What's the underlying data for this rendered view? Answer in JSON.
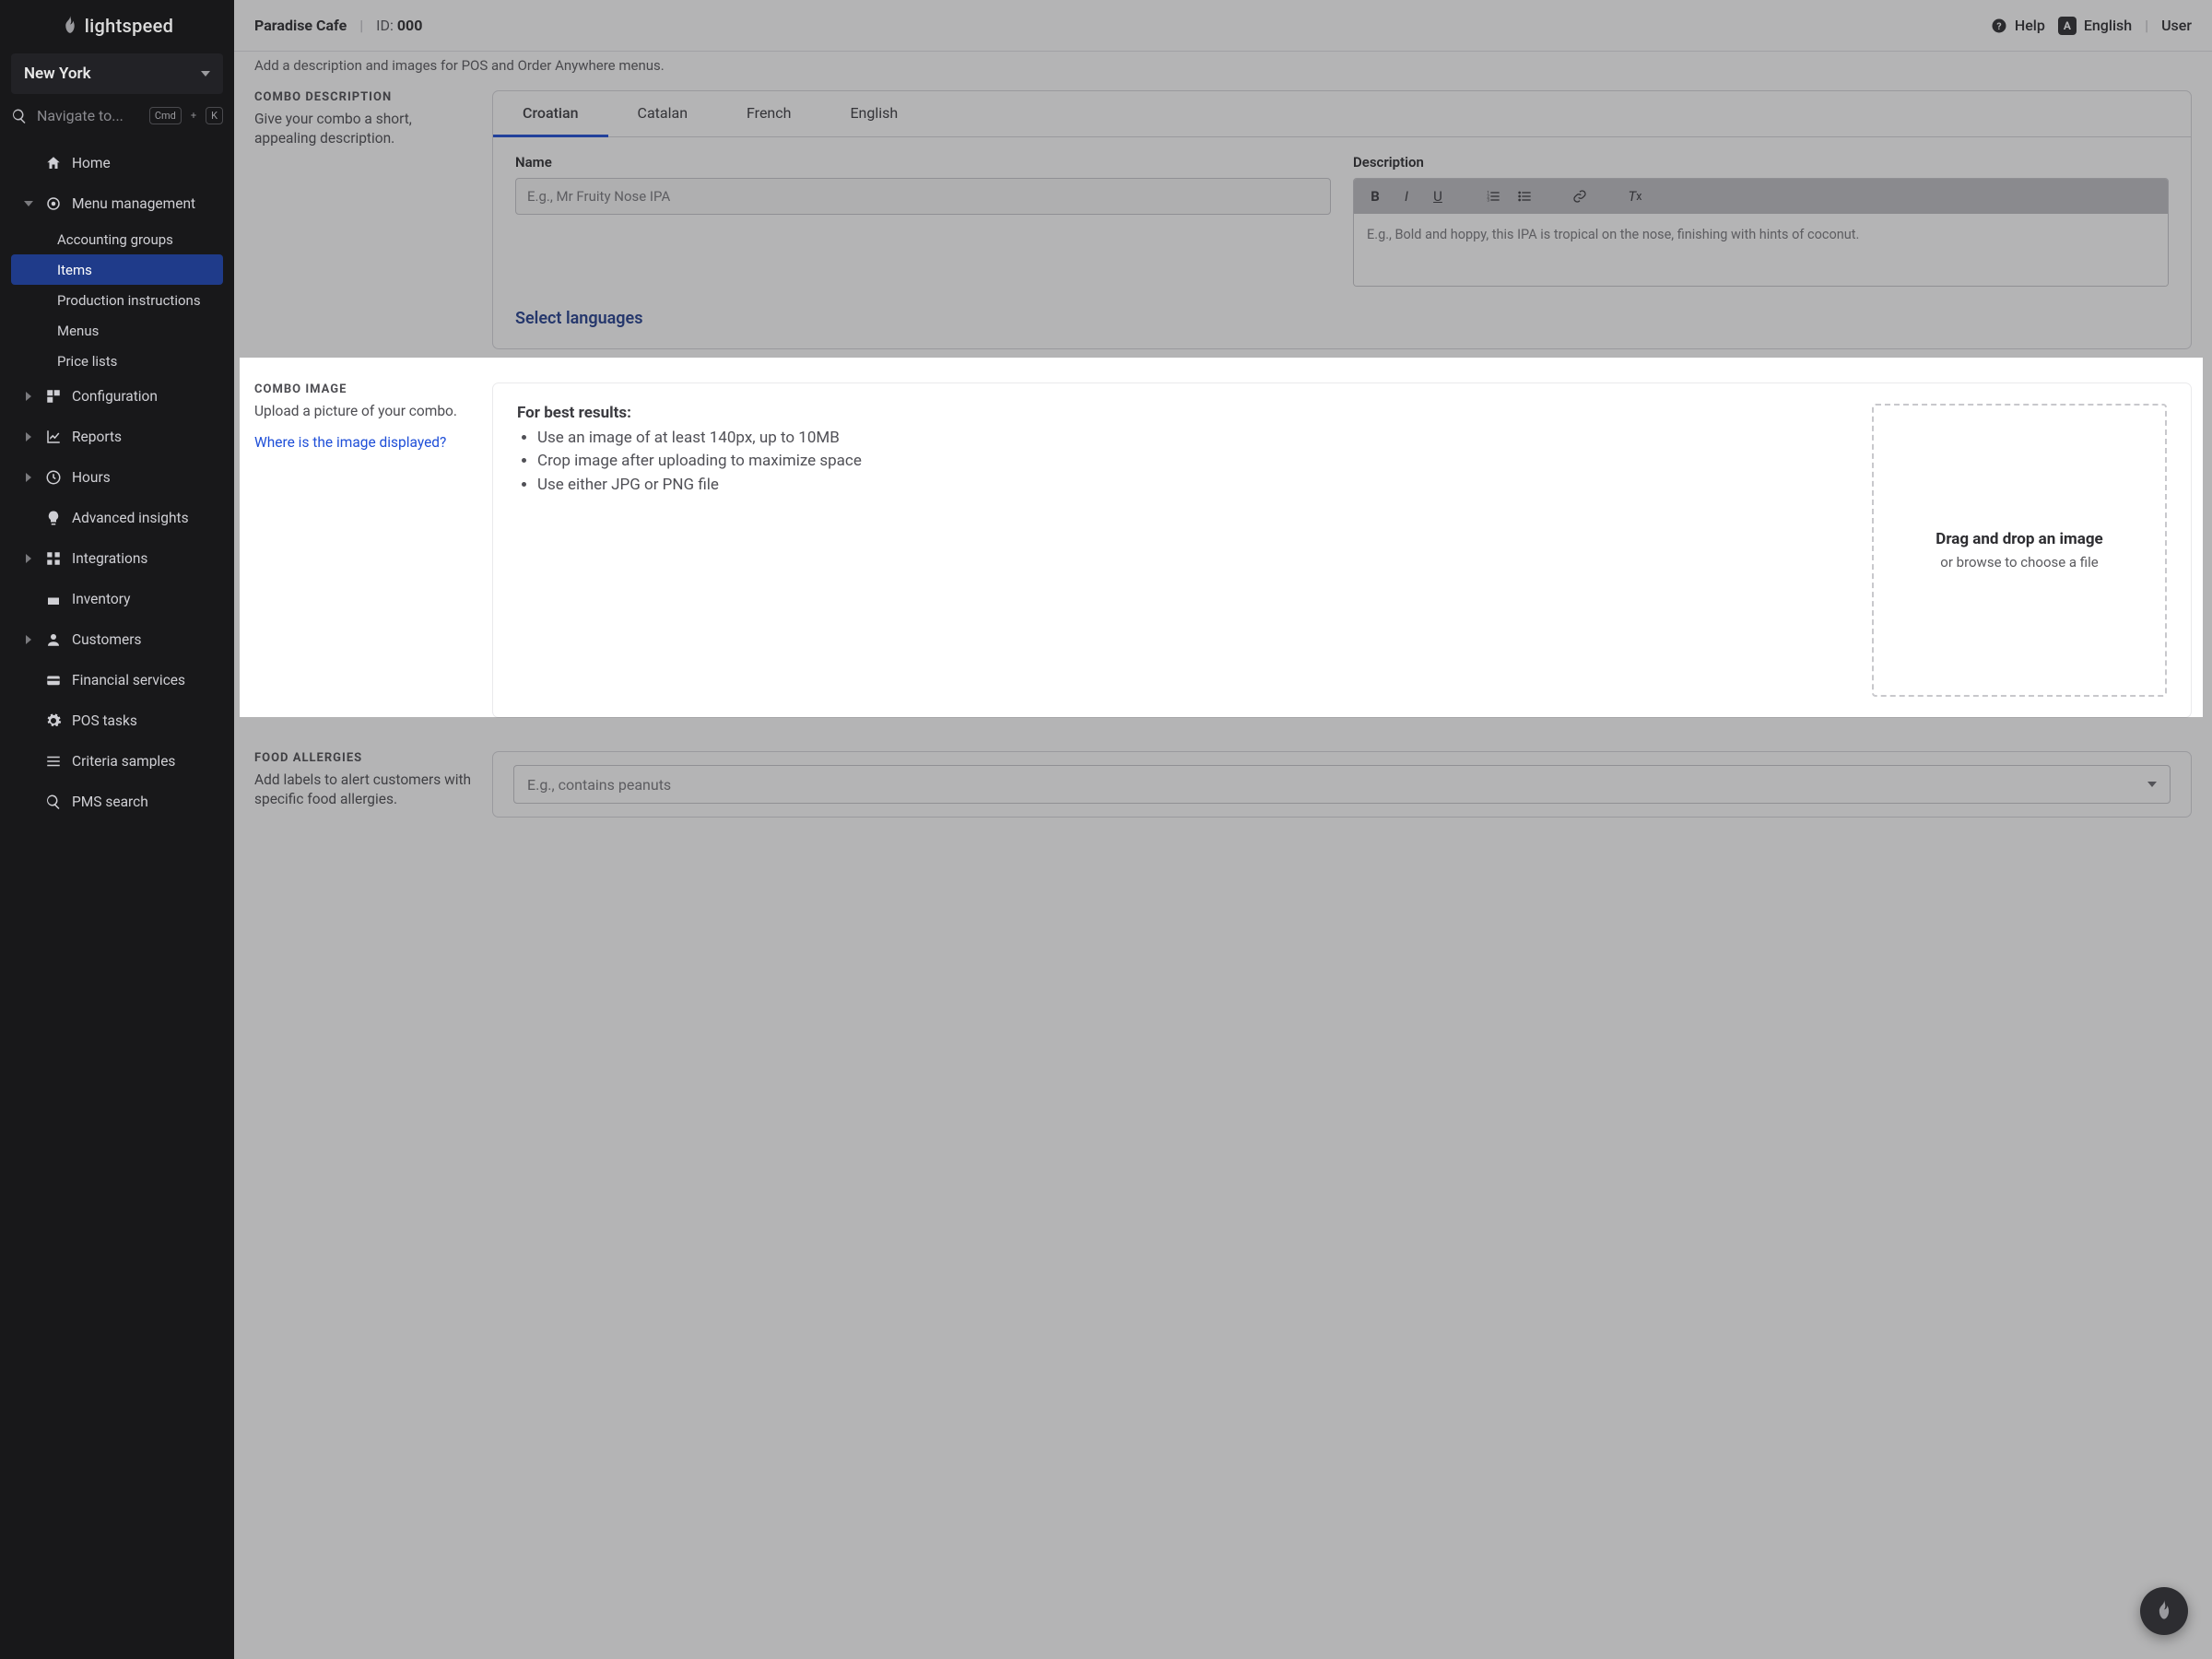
{
  "brand": "lightspeed",
  "location": "New York",
  "search_placeholder": "Navigate to...",
  "kbd": {
    "cmd": "Cmd",
    "plus": "+",
    "k": "K"
  },
  "nav": {
    "home": "Home",
    "menu_mgmt": "Menu management",
    "sub": {
      "accounting": "Accounting groups",
      "items": "Items",
      "production": "Production instructions",
      "menus": "Menus",
      "pricelists": "Price lists"
    },
    "configuration": "Configuration",
    "reports": "Reports",
    "hours": "Hours",
    "insights": "Advanced insights",
    "integrations": "Integrations",
    "inventory": "Inventory",
    "customers": "Customers",
    "financial": "Financial services",
    "pos_tasks": "POS tasks",
    "criteria": "Criteria samples",
    "pms": "PMS search"
  },
  "topbar": {
    "business": "Paradise Cafe",
    "divider": "|",
    "id_label": "ID: ",
    "id_value": "000",
    "help": "Help",
    "language": "English",
    "lang_badge": "A",
    "user": "User"
  },
  "truncated_line": "Add a description and images for POS and Order Anywhere menus.",
  "combo_desc": {
    "heading": "COMBO DESCRIPTION",
    "sub": "Give your combo a short, appealing description.",
    "tabs": {
      "croatian": "Croatian",
      "catalan": "Catalan",
      "french": "French",
      "english": "English"
    },
    "name_label": "Name",
    "name_placeholder": "E.g., Mr Fruity Nose IPA",
    "desc_label": "Description",
    "desc_placeholder": "E.g., Bold and hoppy, this IPA is tropical on the nose, finishing with hints of coconut.",
    "select_languages": "Select languages"
  },
  "combo_image": {
    "heading": "COMBO IMAGE",
    "sub": "Upload a picture of your combo.",
    "link": "Where is the image displayed?",
    "lead": "For best results:",
    "b1": "Use an image of at least 140px, up to 10MB",
    "b2": "Crop image after uploading to maximize space",
    "b3": "Use either JPG or PNG file",
    "dz_title": "Drag and drop an image",
    "dz_sub": "or browse to choose a file"
  },
  "allergies": {
    "heading": "FOOD ALLERGIES",
    "sub": "Add labels to alert customers with specific food allergies.",
    "placeholder": "E.g., contains peanuts"
  }
}
